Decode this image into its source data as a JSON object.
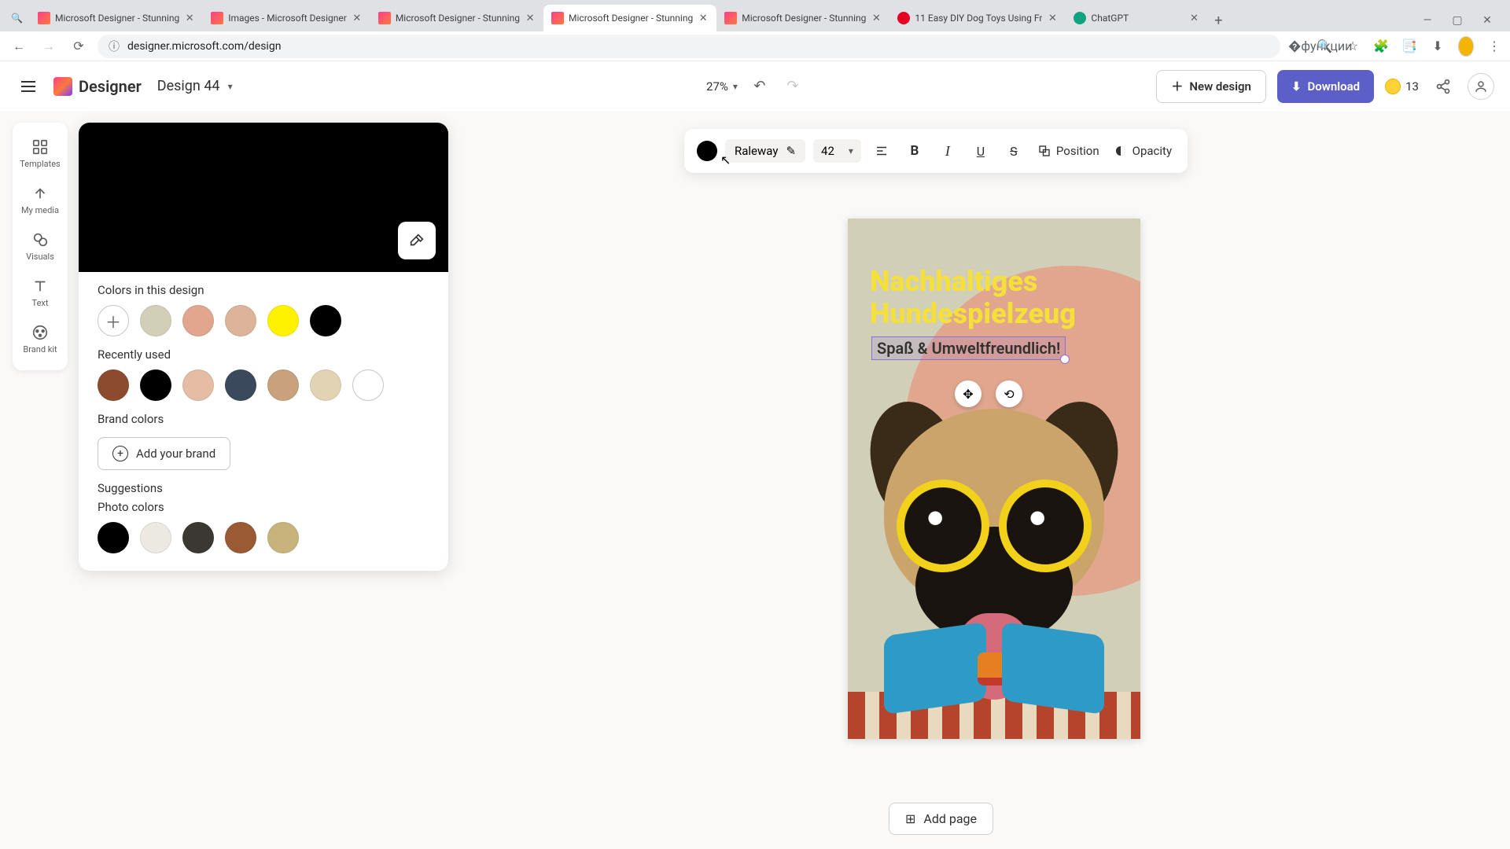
{
  "browser": {
    "tabs": [
      {
        "title": "Microsoft Designer - Stunning",
        "favicon": "designer"
      },
      {
        "title": "Images - Microsoft Designer",
        "favicon": "designer"
      },
      {
        "title": "Microsoft Designer - Stunning",
        "favicon": "designer"
      },
      {
        "title": "Microsoft Designer - Stunning",
        "favicon": "designer",
        "active": true
      },
      {
        "title": "Microsoft Designer - Stunning",
        "favicon": "designer"
      },
      {
        "title": "11 Easy DIY Dog Toys Using Fr",
        "favicon": "pinterest"
      },
      {
        "title": "ChatGPT",
        "favicon": "chatgpt"
      }
    ],
    "url": "designer.microsoft.com/design"
  },
  "header": {
    "brand": "Designer",
    "design_name": "Design 44",
    "zoom": "27%",
    "new_design": "New design",
    "download": "Download",
    "credits": "13"
  },
  "rail": {
    "items": [
      {
        "label": "Templates",
        "icon": "templates"
      },
      {
        "label": "My media",
        "icon": "upload"
      },
      {
        "label": "Visuals",
        "icon": "visuals"
      },
      {
        "label": "Text",
        "icon": "text"
      },
      {
        "label": "Brand kit",
        "icon": "brandkit"
      }
    ]
  },
  "color_panel": {
    "current": "#000000",
    "section_in_design": "Colors in this design",
    "in_design": [
      "#d2cfb9",
      "#e1a68e",
      "#dcb49a",
      "#fff200",
      "#000000"
    ],
    "section_recent": "Recently used",
    "recent": [
      "#8c4a2e",
      "#000000",
      "#e5bda5",
      "#3a4a5c",
      "#c9a17d",
      "#e3d3b5",
      "#ffffff"
    ],
    "section_brand": "Brand colors",
    "add_brand": "Add your brand",
    "section_suggestions": "Suggestions",
    "section_photo": "Photo colors",
    "photo": [
      "#000000",
      "#ece9e2",
      "#3b3833",
      "#9a5a33",
      "#c9b37d"
    ]
  },
  "text_toolbar": {
    "color": "#000000",
    "font": "Raleway",
    "size": "42",
    "position_label": "Position",
    "opacity_label": "Opacity"
  },
  "canvas": {
    "title_line1": "Nachhaltiges",
    "title_line2": "Hundespielzeug",
    "subtitle": "Spaß & Umweltfreundlich!"
  },
  "footer": {
    "add_page": "Add page"
  }
}
